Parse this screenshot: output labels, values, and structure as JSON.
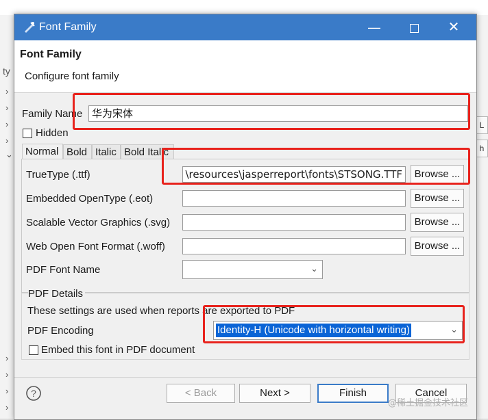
{
  "background": {
    "search_fragment": "ty",
    "right_buttons": [
      "L",
      "h"
    ]
  },
  "dialog": {
    "window_title": "Font Family",
    "header_title": "Font Family",
    "header_desc": "Configure font family",
    "family_name_label": "Family Name",
    "family_name_value": "华为宋体",
    "hidden_label": "Hidden",
    "tabs": [
      "Normal",
      "Bold",
      "Italic",
      "Bold Italic"
    ],
    "rows": [
      {
        "label": "TrueType (.ttf)",
        "value": "\\resources\\jasperreport\\fonts\\STSONG.TTF",
        "button": "Browse ..."
      },
      {
        "label": "Embedded OpenType (.eot)",
        "value": "",
        "button": "Browse ..."
      },
      {
        "label": "Scalable Vector Graphics (.svg)",
        "value": "",
        "button": "Browse ..."
      },
      {
        "label": "Web Open Font Format (.woff)",
        "value": "",
        "button": "Browse ..."
      }
    ],
    "pdf_font_name_label": "PDF Font Name",
    "pdf_details_title": "PDF Details",
    "pdf_details_desc": "These settings are used when reports are exported to PDF",
    "pdf_encoding_label": "PDF Encoding",
    "pdf_encoding_value": "Identity-H (Unicode with horizontal writing)",
    "embed_label": "Embed this font in PDF document",
    "buttons": {
      "back": "< Back",
      "next": "Next >",
      "finish": "Finish",
      "cancel": "Cancel"
    }
  },
  "watermark": "@稀土掘金技术社区",
  "colors": {
    "titlebar": "#3a7bc8",
    "highlight": "#e8221c",
    "selection": "#0a64d6"
  },
  "icons": {
    "window": "eclipse-icon",
    "help": "help-icon",
    "minimize": "minimize-icon",
    "maximize": "maximize-icon",
    "close": "close-icon"
  }
}
